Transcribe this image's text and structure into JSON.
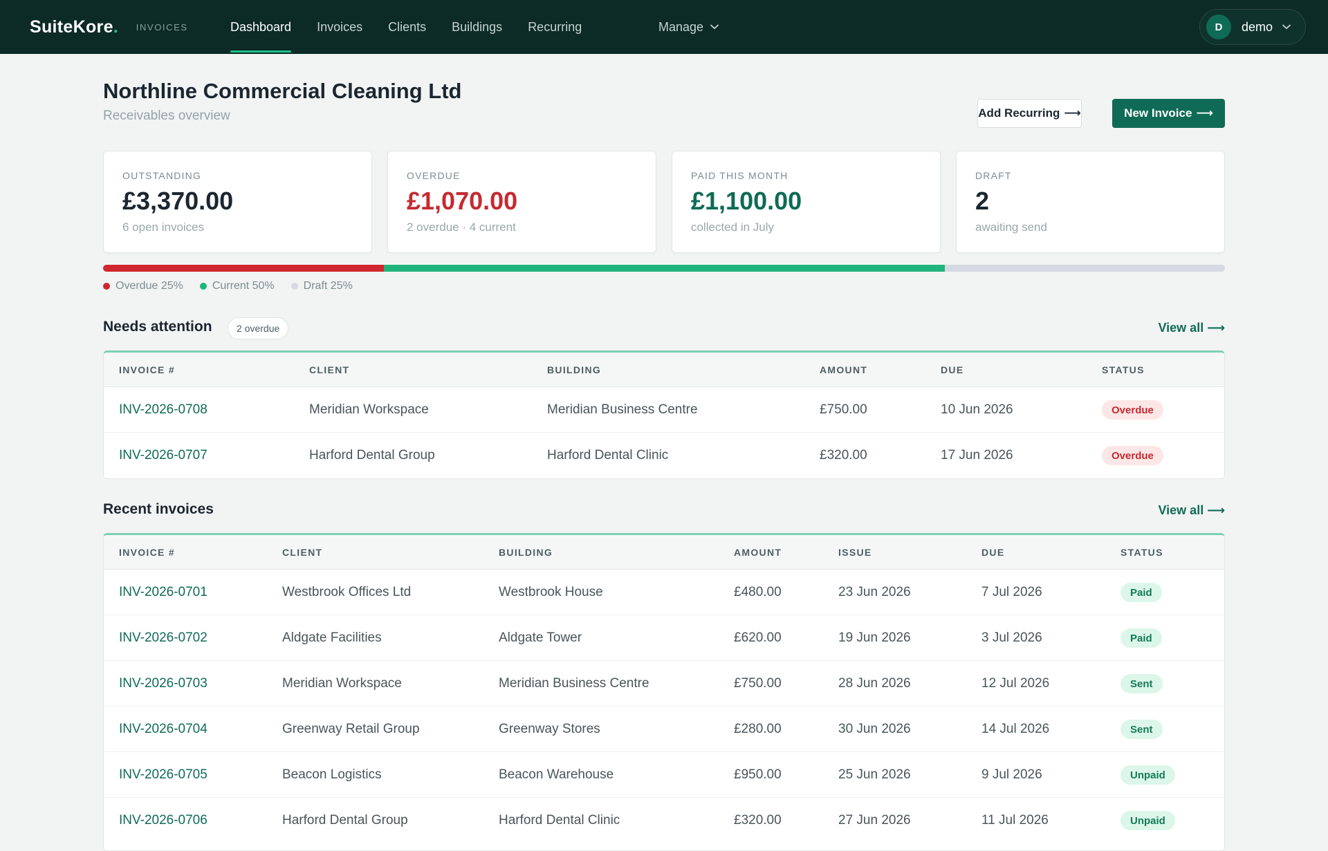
{
  "nav": {
    "brand": "SuiteKore",
    "brand_dot": ".",
    "brand_sub": "INVOICES",
    "links": [
      "Dashboard",
      "Invoices",
      "Clients",
      "Buildings",
      "Recurring"
    ],
    "manage": "Manage",
    "user": {
      "initial": "D",
      "name": "demo"
    }
  },
  "header": {
    "title": "Northline Commercial Cleaning Ltd",
    "subtitle": "Receivables overview",
    "add_recurring": "Add Recurring",
    "new_invoice": "New Invoice",
    "arrow": "⟶"
  },
  "kpis": [
    {
      "label": "OUTSTANDING",
      "value": "£3,370.00",
      "note": "6 open invoices",
      "color": "#1b2630"
    },
    {
      "label": "OVERDUE",
      "value": "£1,070.00",
      "note": "2 overdue · 4 current",
      "color": "#c42b30"
    },
    {
      "label": "PAID THIS MONTH",
      "value": "£1,100.00",
      "note": "collected in July",
      "color": "#0f6b55"
    },
    {
      "label": "DRAFT",
      "value": "2",
      "note": "awaiting send",
      "color": "#1b2630"
    }
  ],
  "distribution": [
    {
      "label": "Overdue 25%",
      "fraction": 0.25,
      "color": "#d0262d"
    },
    {
      "label": "Current 50%",
      "fraction": 0.5,
      "color": "#1fb57d"
    },
    {
      "label": "Draft 25%",
      "fraction": 0.25,
      "color": "#d5d9e2"
    }
  ],
  "attention": {
    "title": "Needs attention",
    "badge": "2 overdue",
    "view_all": "View all ⟶",
    "columns": [
      "INVOICE #",
      "CLIENT",
      "BUILDING",
      "AMOUNT",
      "DUE",
      "STATUS"
    ],
    "rows": [
      {
        "invoice": "INV-2026-0708",
        "client": "Meridian Workspace",
        "building": "Meridian Business Centre",
        "amount": "£750.00",
        "due": "10 Jun 2026",
        "status": "Overdue"
      },
      {
        "invoice": "INV-2026-0707",
        "client": "Harford Dental Group",
        "building": "Harford Dental Clinic",
        "amount": "£320.00",
        "due": "17 Jun 2026",
        "status": "Overdue"
      }
    ]
  },
  "recent": {
    "title": "Recent invoices",
    "view_all": "View all ⟶",
    "columns": [
      "INVOICE #",
      "CLIENT",
      "BUILDING",
      "AMOUNT",
      "ISSUE",
      "DUE",
      "STATUS"
    ],
    "rows": [
      {
        "invoice": "INV-2026-0701",
        "client": "Westbrook Offices Ltd",
        "building": "Westbrook House",
        "amount": "£480.00",
        "issue": "23 Jun 2026",
        "due": "7 Jul 2026",
        "status": "Paid"
      },
      {
        "invoice": "INV-2026-0702",
        "client": "Aldgate Facilities",
        "building": "Aldgate Tower",
        "amount": "£620.00",
        "issue": "19 Jun 2026",
        "due": "3 Jul 2026",
        "status": "Paid"
      },
      {
        "invoice": "INV-2026-0703",
        "client": "Meridian Workspace",
        "building": "Meridian Business Centre",
        "amount": "£750.00",
        "issue": "28 Jun 2026",
        "due": "12 Jul 2026",
        "status": "Sent"
      },
      {
        "invoice": "INV-2026-0704",
        "client": "Greenway Retail Group",
        "building": "Greenway Stores",
        "amount": "£280.00",
        "issue": "30 Jun 2026",
        "due": "14 Jul 2026",
        "status": "Sent"
      },
      {
        "invoice": "INV-2026-0705",
        "client": "Beacon Logistics",
        "building": "Beacon Warehouse",
        "amount": "£950.00",
        "issue": "25 Jun 2026",
        "due": "9 Jul 2026",
        "status": "Unpaid"
      },
      {
        "invoice": "INV-2026-0706",
        "client": "Harford Dental Group",
        "building": "Harford Dental Clinic",
        "amount": "£320.00",
        "issue": "27 Jun 2026",
        "due": "11 Jul 2026",
        "status": "Unpaid"
      }
    ]
  }
}
